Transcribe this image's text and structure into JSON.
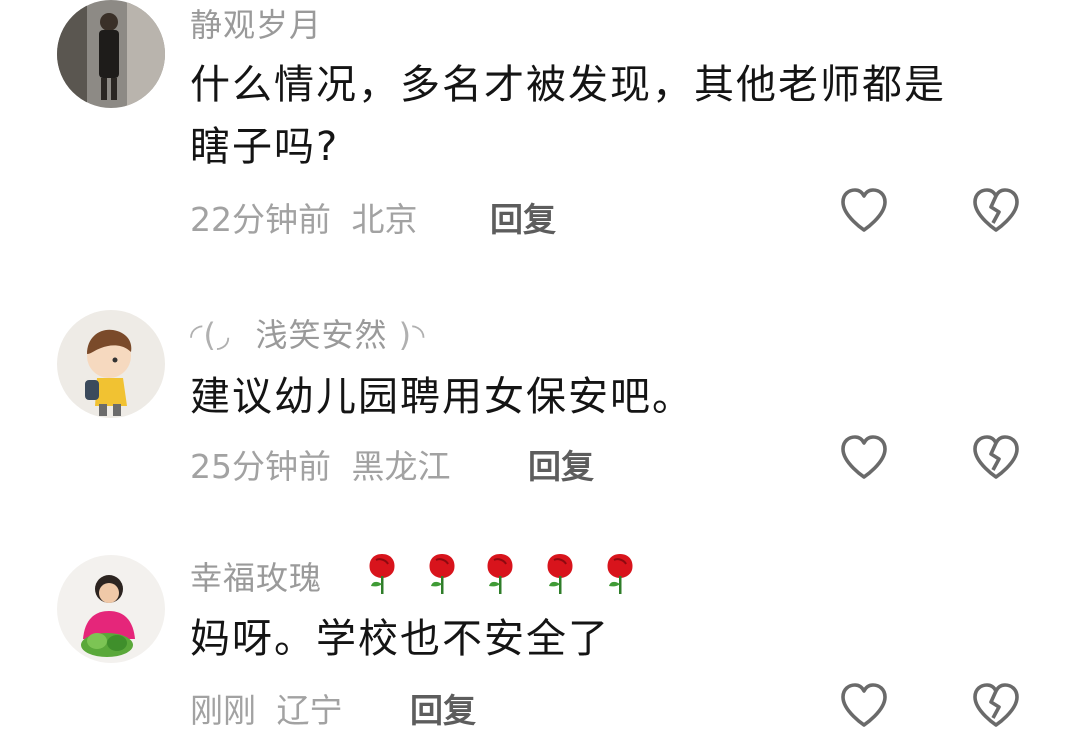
{
  "comments": [
    {
      "username": "静观岁月",
      "text_line1": "什么情况，多名才被发现，其他老师都是",
      "text_line2": "瞎子吗?",
      "time": "22分钟前",
      "location": "北京",
      "reply_label": "回复",
      "like_icon": "heart-outline-icon",
      "dislike_icon": "broken-heart-icon"
    },
    {
      "username_prefix": "◜(◞",
      "username": "浅笑安然",
      "username_suffix": ")◝",
      "text_line1": "建议幼儿园聘用女保安吧。",
      "time": "25分钟前",
      "location": "黑龙江",
      "reply_label": "回复",
      "like_icon": "heart-outline-icon",
      "dislike_icon": "broken-heart-icon"
    },
    {
      "username": "幸福玫瑰",
      "username_emoji": "rose-emoji x5",
      "text_line1": "妈呀。学校也不安全了",
      "time": "刚刚",
      "location": "辽宁",
      "reply_label": "回复",
      "like_icon": "heart-outline-icon",
      "dislike_icon": "broken-heart-icon"
    }
  ],
  "colors": {
    "username": "#9a9a9a",
    "text": "#141414",
    "meta": "#a2a2a2",
    "reply": "#5d5d5d",
    "icon": "#6a6a6a",
    "rose": "#d8141c"
  }
}
